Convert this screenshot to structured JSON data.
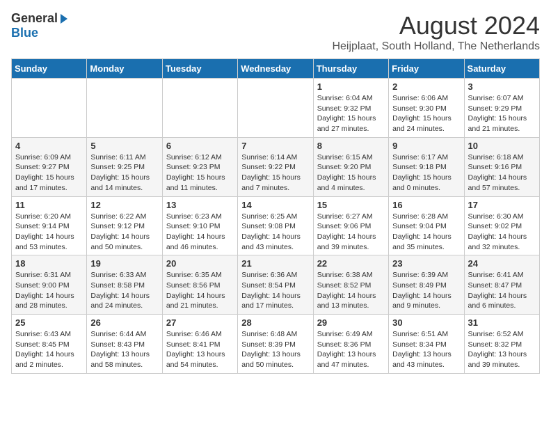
{
  "logo": {
    "general": "General",
    "blue": "Blue"
  },
  "title": "August 2024",
  "location": "Heijplaat, South Holland, The Netherlands",
  "headers": [
    "Sunday",
    "Monday",
    "Tuesday",
    "Wednesday",
    "Thursday",
    "Friday",
    "Saturday"
  ],
  "weeks": [
    [
      {
        "day": "",
        "info": ""
      },
      {
        "day": "",
        "info": ""
      },
      {
        "day": "",
        "info": ""
      },
      {
        "day": "",
        "info": ""
      },
      {
        "day": "1",
        "info": "Sunrise: 6:04 AM\nSunset: 9:32 PM\nDaylight: 15 hours and 27 minutes."
      },
      {
        "day": "2",
        "info": "Sunrise: 6:06 AM\nSunset: 9:30 PM\nDaylight: 15 hours and 24 minutes."
      },
      {
        "day": "3",
        "info": "Sunrise: 6:07 AM\nSunset: 9:29 PM\nDaylight: 15 hours and 21 minutes."
      }
    ],
    [
      {
        "day": "4",
        "info": "Sunrise: 6:09 AM\nSunset: 9:27 PM\nDaylight: 15 hours and 17 minutes."
      },
      {
        "day": "5",
        "info": "Sunrise: 6:11 AM\nSunset: 9:25 PM\nDaylight: 15 hours and 14 minutes."
      },
      {
        "day": "6",
        "info": "Sunrise: 6:12 AM\nSunset: 9:23 PM\nDaylight: 15 hours and 11 minutes."
      },
      {
        "day": "7",
        "info": "Sunrise: 6:14 AM\nSunset: 9:22 PM\nDaylight: 15 hours and 7 minutes."
      },
      {
        "day": "8",
        "info": "Sunrise: 6:15 AM\nSunset: 9:20 PM\nDaylight: 15 hours and 4 minutes."
      },
      {
        "day": "9",
        "info": "Sunrise: 6:17 AM\nSunset: 9:18 PM\nDaylight: 15 hours and 0 minutes."
      },
      {
        "day": "10",
        "info": "Sunrise: 6:18 AM\nSunset: 9:16 PM\nDaylight: 14 hours and 57 minutes."
      }
    ],
    [
      {
        "day": "11",
        "info": "Sunrise: 6:20 AM\nSunset: 9:14 PM\nDaylight: 14 hours and 53 minutes."
      },
      {
        "day": "12",
        "info": "Sunrise: 6:22 AM\nSunset: 9:12 PM\nDaylight: 14 hours and 50 minutes."
      },
      {
        "day": "13",
        "info": "Sunrise: 6:23 AM\nSunset: 9:10 PM\nDaylight: 14 hours and 46 minutes."
      },
      {
        "day": "14",
        "info": "Sunrise: 6:25 AM\nSunset: 9:08 PM\nDaylight: 14 hours and 43 minutes."
      },
      {
        "day": "15",
        "info": "Sunrise: 6:27 AM\nSunset: 9:06 PM\nDaylight: 14 hours and 39 minutes."
      },
      {
        "day": "16",
        "info": "Sunrise: 6:28 AM\nSunset: 9:04 PM\nDaylight: 14 hours and 35 minutes."
      },
      {
        "day": "17",
        "info": "Sunrise: 6:30 AM\nSunset: 9:02 PM\nDaylight: 14 hours and 32 minutes."
      }
    ],
    [
      {
        "day": "18",
        "info": "Sunrise: 6:31 AM\nSunset: 9:00 PM\nDaylight: 14 hours and 28 minutes."
      },
      {
        "day": "19",
        "info": "Sunrise: 6:33 AM\nSunset: 8:58 PM\nDaylight: 14 hours and 24 minutes."
      },
      {
        "day": "20",
        "info": "Sunrise: 6:35 AM\nSunset: 8:56 PM\nDaylight: 14 hours and 21 minutes."
      },
      {
        "day": "21",
        "info": "Sunrise: 6:36 AM\nSunset: 8:54 PM\nDaylight: 14 hours and 17 minutes."
      },
      {
        "day": "22",
        "info": "Sunrise: 6:38 AM\nSunset: 8:52 PM\nDaylight: 14 hours and 13 minutes."
      },
      {
        "day": "23",
        "info": "Sunrise: 6:39 AM\nSunset: 8:49 PM\nDaylight: 14 hours and 9 minutes."
      },
      {
        "day": "24",
        "info": "Sunrise: 6:41 AM\nSunset: 8:47 PM\nDaylight: 14 hours and 6 minutes."
      }
    ],
    [
      {
        "day": "25",
        "info": "Sunrise: 6:43 AM\nSunset: 8:45 PM\nDaylight: 14 hours and 2 minutes."
      },
      {
        "day": "26",
        "info": "Sunrise: 6:44 AM\nSunset: 8:43 PM\nDaylight: 13 hours and 58 minutes."
      },
      {
        "day": "27",
        "info": "Sunrise: 6:46 AM\nSunset: 8:41 PM\nDaylight: 13 hours and 54 minutes."
      },
      {
        "day": "28",
        "info": "Sunrise: 6:48 AM\nSunset: 8:39 PM\nDaylight: 13 hours and 50 minutes."
      },
      {
        "day": "29",
        "info": "Sunrise: 6:49 AM\nSunset: 8:36 PM\nDaylight: 13 hours and 47 minutes."
      },
      {
        "day": "30",
        "info": "Sunrise: 6:51 AM\nSunset: 8:34 PM\nDaylight: 13 hours and 43 minutes."
      },
      {
        "day": "31",
        "info": "Sunrise: 6:52 AM\nSunset: 8:32 PM\nDaylight: 13 hours and 39 minutes."
      }
    ]
  ]
}
